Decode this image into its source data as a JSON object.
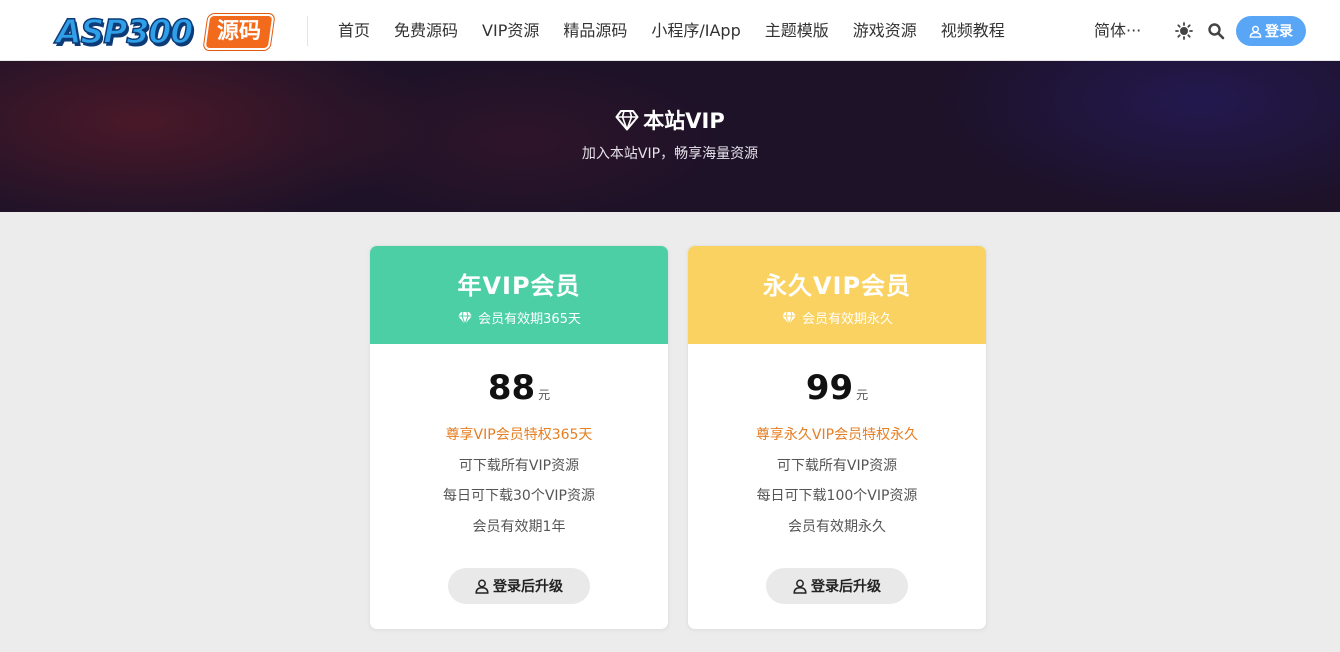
{
  "header": {
    "logo": {
      "text": "ASP300",
      "badge": "源码"
    },
    "nav": [
      "首页",
      "免费源码",
      "VIP资源",
      "精品源码",
      "小程序/IApp",
      "主题模版",
      "游戏资源",
      "视频教程"
    ],
    "language": "简体···",
    "icons": [
      "sun-icon",
      "search-icon"
    ],
    "login_label": "登录"
  },
  "hero": {
    "title": "本站VIP",
    "subtitle": "加入本站VIP，畅享海量资源",
    "icon": "diamond-icon"
  },
  "plans": [
    {
      "title": "年VIP会员",
      "validity": "会员有效期365天",
      "price": "88",
      "unit": "元",
      "highlight": "尊享VIP会员特权365天",
      "features": [
        "可下载所有VIP资源",
        "每日可下载30个VIP资源",
        "会员有效期1年"
      ],
      "button_label": "登录后升级",
      "color": "#4ccfa4"
    },
    {
      "title": "永久VIP会员",
      "validity": "会员有效期永久",
      "price": "99",
      "unit": "元",
      "highlight": "尊享永久VIP会员特权永久",
      "features": [
        "可下载所有VIP资源",
        "每日可下载100个VIP资源",
        "会员有效期永久"
      ],
      "button_label": "登录后升级",
      "color": "#f9d262"
    }
  ],
  "colors": {
    "accent": "#5aa6f6",
    "highlight_text": "#e67e22",
    "hero_bg": "#1d1228"
  }
}
